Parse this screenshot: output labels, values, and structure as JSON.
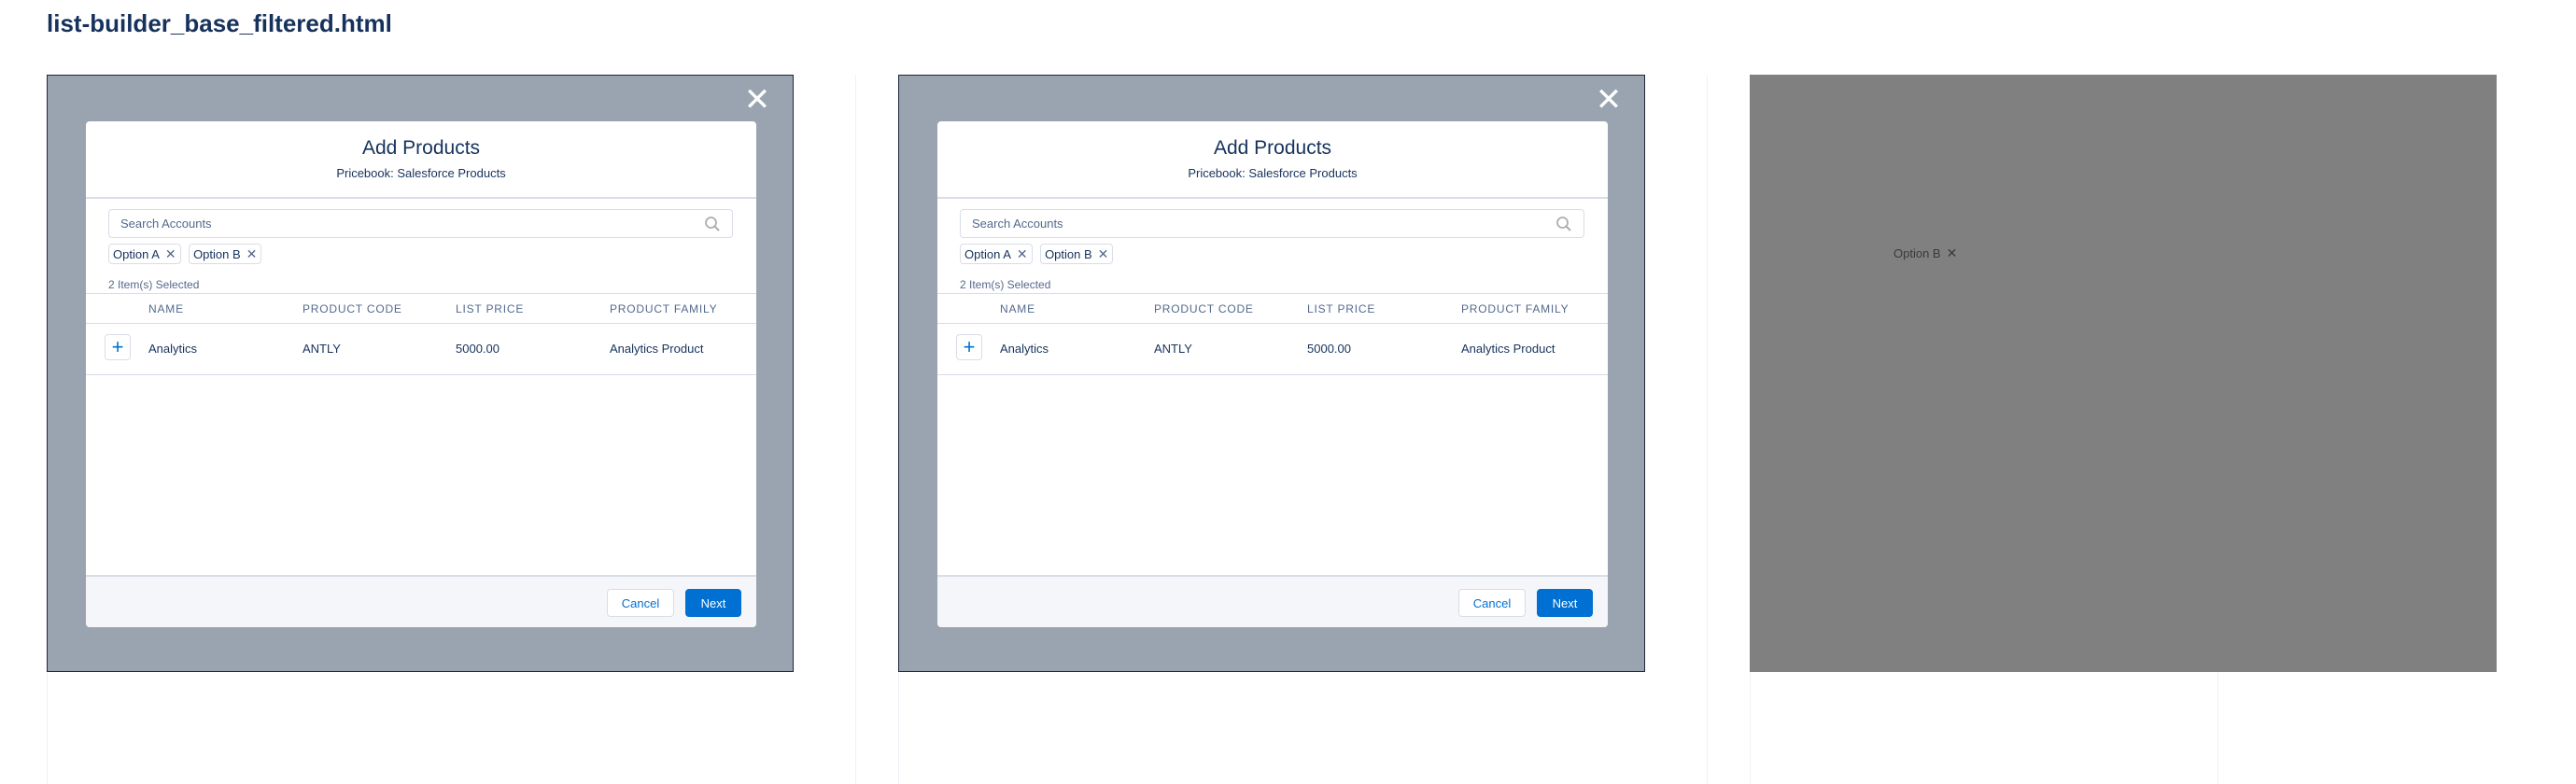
{
  "page": {
    "title": "list-builder_base_filtered.html"
  },
  "modal": {
    "close_icon": "close-icon",
    "title": "Add Products",
    "subtitle": "Pricebook: Salesforce Products",
    "search": {
      "placeholder": "Search Accounts",
      "icon": "search-icon"
    },
    "pills": [
      {
        "label": "Option A",
        "remove_icon": "close-icon"
      },
      {
        "label": "Option B",
        "remove_icon": "close-icon"
      }
    ],
    "selected_count": "2 Item(s) Selected",
    "table": {
      "columns": [
        "NAME",
        "PRODUCT CODE",
        "LIST PRICE",
        "PRODUCT FAMILY"
      ],
      "rows": [
        {
          "add_icon": "plus-icon",
          "name": "Analytics",
          "code": "ANTLY",
          "price": "5000.00",
          "family": "Analytics Product"
        }
      ]
    },
    "footer": {
      "cancel": "Cancel",
      "next": "Next"
    }
  },
  "third_frame": {
    "pill_label": "Option B"
  },
  "colors": {
    "backdrop": "#99a4b0",
    "third_backdrop": "#808080",
    "brand": "#0070d2",
    "text": "#16325c",
    "muted": "#54698d",
    "border": "#d8dde6"
  }
}
